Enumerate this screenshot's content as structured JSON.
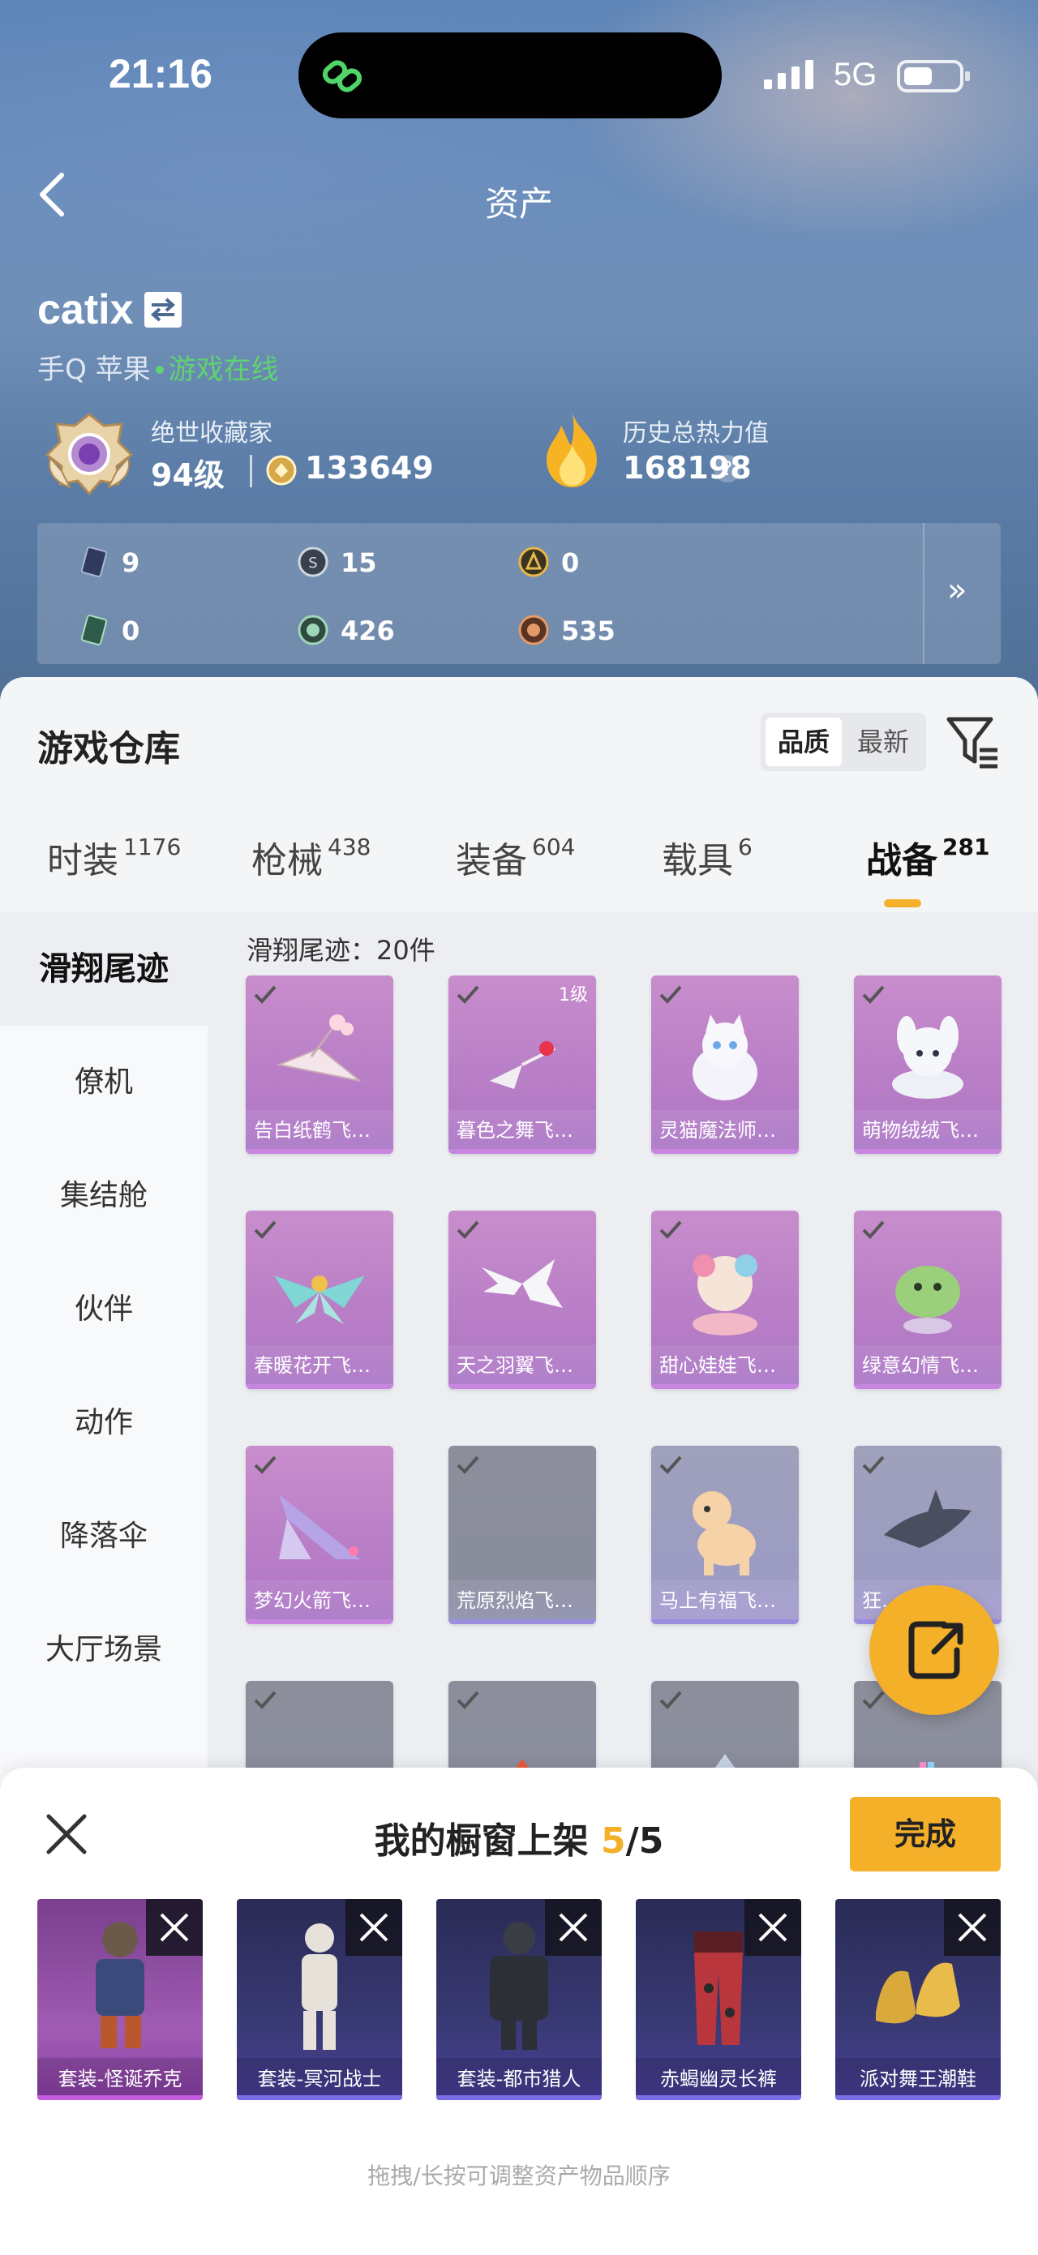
{
  "status": {
    "time": "21:16",
    "network": "5G"
  },
  "nav": {
    "title": "资产"
  },
  "user": {
    "name": "catix",
    "platform": "手Q 苹果",
    "online_status": "游戏在线"
  },
  "collector": {
    "label": "绝世收藏家",
    "level": "94级",
    "coins": "133649"
  },
  "heat": {
    "label": "历史总热力值",
    "value": "168198",
    "help": "?"
  },
  "currencies": [
    {
      "icon": "card-currency-icon",
      "value": "9"
    },
    {
      "icon": "silver-coin-icon",
      "value": "15"
    },
    {
      "icon": "gold-coin-icon",
      "value": "0"
    },
    {
      "icon": "green-card-icon",
      "value": "0"
    },
    {
      "icon": "green-coin-icon",
      "value": "426"
    },
    {
      "icon": "bronze-coin-icon",
      "value": "535"
    }
  ],
  "currency_more": "»",
  "warehouse": {
    "title": "游戏仓库",
    "sort": {
      "quality": "品质",
      "latest": "最新"
    },
    "tabs": [
      {
        "label": "时装",
        "count": "1176"
      },
      {
        "label": "枪械",
        "count": "438"
      },
      {
        "label": "装备",
        "count": "604"
      },
      {
        "label": "载具",
        "count": "6"
      },
      {
        "label": "战备",
        "count": "281"
      }
    ],
    "sidebar": [
      "滑翔尾迹",
      "僚机",
      "集结舱",
      "伙伴",
      "动作",
      "降落伞",
      "大厅场景"
    ],
    "grid_header": "滑翔尾迹：20件",
    "items": [
      {
        "name": "告白纸鹤飞…",
        "level": ""
      },
      {
        "name": "暮色之舞飞…",
        "level": "1级"
      },
      {
        "name": "灵猫魔法师…",
        "level": ""
      },
      {
        "name": "萌物绒绒飞…",
        "level": ""
      },
      {
        "name": "春暖花开飞…",
        "level": ""
      },
      {
        "name": "天之羽翼飞…",
        "level": ""
      },
      {
        "name": "甜心娃娃飞…",
        "level": ""
      },
      {
        "name": "绿意幻情飞…",
        "level": ""
      },
      {
        "name": "梦幻火箭飞…",
        "level": ""
      },
      {
        "name": "荒原烈焰飞…",
        "level": ""
      },
      {
        "name": "马上有福飞…",
        "level": ""
      },
      {
        "name": "狂…",
        "level": ""
      }
    ]
  },
  "showcase": {
    "title": "我的橱窗上架",
    "count": "5",
    "total": "/5",
    "done": "完成",
    "items": [
      {
        "label": "套装-怪诞乔克"
      },
      {
        "label": "套装-冥河战士"
      },
      {
        "label": "套装-都市猎人"
      },
      {
        "label": "赤蝎幽灵长裤"
      },
      {
        "label": "派对舞王潮鞋"
      }
    ],
    "hint": "拖拽/长按可调整资产物品顺序"
  },
  "colors": {
    "accent": "#f5b02a",
    "online": "#5fd36f",
    "item_purple": "#b57bc5"
  }
}
